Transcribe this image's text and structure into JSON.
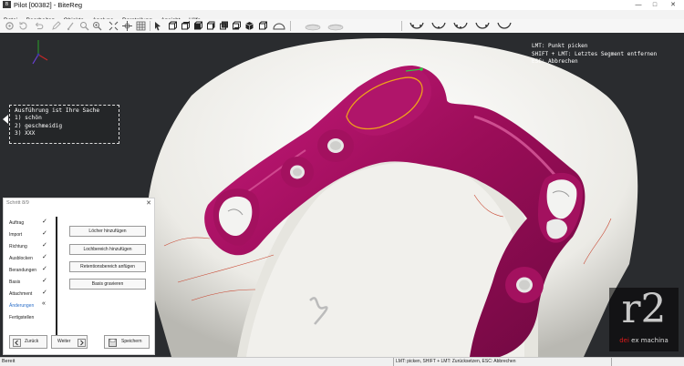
{
  "window": {
    "title": "Pilot [00382] - BiteReg",
    "app_icon": "app-icon"
  },
  "menu": [
    "Datei",
    "Bearbeiten",
    "Objekte",
    "Analyse",
    "Darstellung",
    "Ansicht",
    "Hilfe"
  ],
  "toolbar": {
    "groups": [
      [
        "settings-icon",
        "refresh-icon",
        "undo-icon",
        "pencil-icon",
        "brush-icon",
        "zoom-icon",
        "search-icon",
        "fit-icon",
        "crosshair-icon",
        "grid-icon"
      ],
      [
        "select-icon",
        "cube-front-icon",
        "cube-top-icon",
        "cube-left-icon",
        "cube-right-icon",
        "cube-back-icon",
        "cube-bottom-icon",
        "cube-iso-icon",
        "dome-icon"
      ],
      [
        "model-jaw-icon",
        "model-jaw2-icon"
      ],
      [
        "tooth-view-1-icon",
        "tooth-view-2-icon",
        "tooth-view-3-icon",
        "tooth-view-4-icon",
        "tooth-view-5-icon"
      ]
    ]
  },
  "viewport": {
    "hints": [
      "LMT: Punkt picken",
      "SHIFT + LMT: Letztes Segment entfernen",
      "ESC: Abbrechen"
    ],
    "question": [
      "Ausführung ist Ihre Sache",
      "1) schön",
      "2) geschmeidig",
      "3) XXX"
    ],
    "colors": {
      "model": "#f2f2ef",
      "prosthesis": "#a0105e",
      "outline": "#f0a21a",
      "point": "#2ecc40"
    }
  },
  "wizard": {
    "title": "Schritt 8/9",
    "steps": [
      {
        "label": "Auftrag",
        "done": true
      },
      {
        "label": "Import",
        "done": true
      },
      {
        "label": "Richtung",
        "done": true
      },
      {
        "label": "Ausblocken",
        "done": true
      },
      {
        "label": "Berandungen",
        "done": true
      },
      {
        "label": "Basis",
        "done": true
      },
      {
        "label": "Attachment",
        "done": true
      },
      {
        "label": "Änderungen",
        "done": false,
        "current": true
      },
      {
        "label": "Fertigstellen",
        "done": false
      }
    ],
    "check_mark": "✓",
    "current_mark": "«",
    "actions": [
      "Löcher hinzufügen",
      "Lochbereich hinzufügen",
      "Retentionsbereich anfügen",
      "Basis gravieren"
    ],
    "back_label": "Zurück",
    "next_label": "Weiter",
    "save_label": "Speichern"
  },
  "status": {
    "left": "Bereit",
    "middle": "LMT: picken, SHIFT + LMT: Zurücksetzen, ESC: Abbrechen"
  },
  "logo": {
    "main": "r2",
    "sub_red": "dei",
    "sub_rest": " ex machina"
  }
}
